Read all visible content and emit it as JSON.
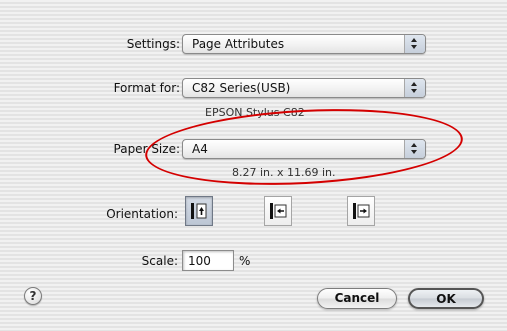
{
  "settings": {
    "label": "Settings:",
    "value": "Page Attributes"
  },
  "format_for": {
    "label": "Format for:",
    "value": "C82 Series(USB)",
    "printer_description": "EPSON Stylus C82"
  },
  "paper_size": {
    "label": "Paper Size:",
    "value": "A4",
    "dimensions": "8.27 in. x 11.69 in."
  },
  "orientation": {
    "label": "Orientation:",
    "options": [
      "portrait",
      "landscape-left",
      "landscape-right"
    ],
    "selected": "portrait"
  },
  "scale": {
    "label": "Scale:",
    "value": "100",
    "unit": "%"
  },
  "buttons": {
    "help": "?",
    "cancel": "Cancel",
    "ok": "OK"
  },
  "colors": {
    "annotation": "#d40000",
    "background": "#ececec"
  },
  "icons": {
    "help": "help-icon",
    "popup_arrows": "up-down-arrows-icon"
  }
}
